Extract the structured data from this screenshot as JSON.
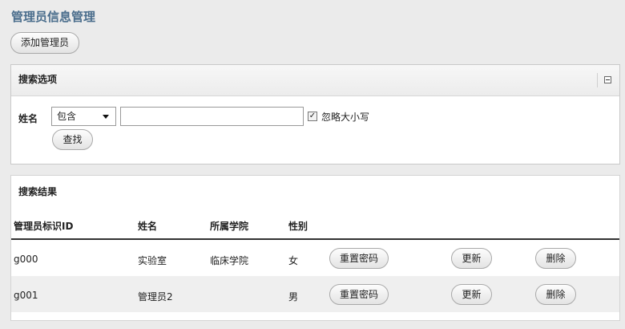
{
  "page": {
    "title": "管理员信息管理"
  },
  "toolbar": {
    "add_label": "添加管理员"
  },
  "search": {
    "title": "搜索选项",
    "name_label": "姓名",
    "match_mode": "包含",
    "query_value": "",
    "ignore_case_checked": true,
    "ignore_case_label": "忽略大小写",
    "search_label": "查找"
  },
  "results": {
    "title": "搜索结果",
    "columns": [
      "管理员标识ID",
      "姓名",
      "所属学院",
      "性别"
    ],
    "rows": [
      {
        "id": "g000",
        "name": "实验室",
        "college": "临床学院",
        "gender": "女"
      },
      {
        "id": "g001",
        "name": "管理员2",
        "college": "",
        "gender": "男"
      }
    ],
    "actions": {
      "reset_password": "重置密码",
      "update": "更新",
      "delete": "删除"
    }
  }
}
